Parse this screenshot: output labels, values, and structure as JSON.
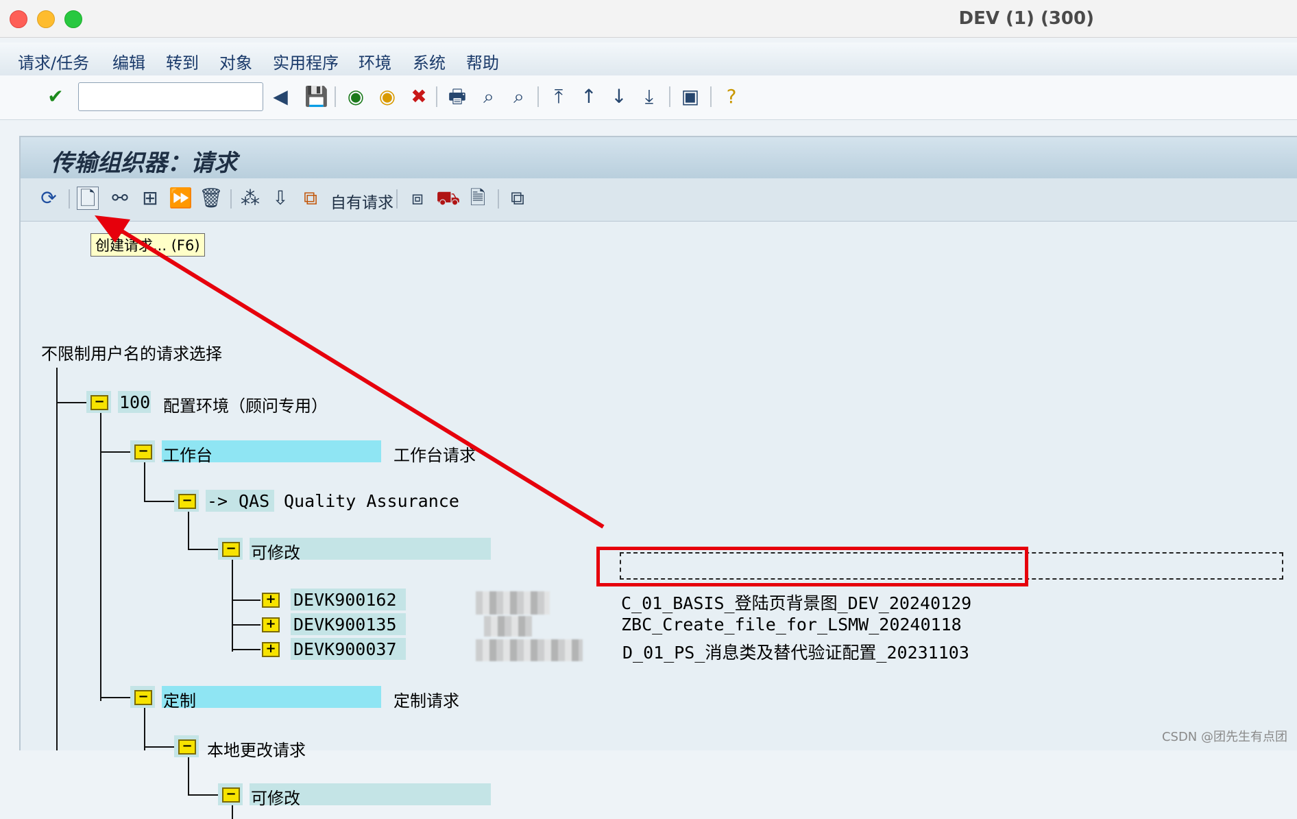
{
  "window": {
    "title": "DEV (1) (300)"
  },
  "menubar": {
    "items": [
      "请求/任务",
      "编辑",
      "转到",
      "对象",
      "实用程序",
      "环境",
      "系统",
      "帮助"
    ]
  },
  "toolbar": {
    "command_field_value": ""
  },
  "page": {
    "title": "传输组织器：请求",
    "own_requests_label": "自有请求",
    "tooltip": "创建请求... (F6)"
  },
  "tree": {
    "root_label": "不限制用户名的请求选择",
    "client": {
      "number": "100",
      "label": "配置环境（顾问专用）"
    },
    "workbench": {
      "label": "工作台",
      "description": "工作台请求"
    },
    "target": {
      "prefix": "->",
      "system": "QAS",
      "description": "Quality Assurance"
    },
    "modifiable_label": "可修改",
    "requests": [
      {
        "id": "DEVK900162",
        "description": "C_01_BASIS_登陆页背景图_DEV_20240129"
      },
      {
        "id": "DEVK900135",
        "description": "ZBC_Create_file_for_LSMW_20240118"
      },
      {
        "id": "DEVK900037",
        "description": "D_01_PS_消息类及替代验证配置_20231103"
      }
    ],
    "customizing": {
      "label": "定制",
      "description": "定制请求"
    },
    "local_change": {
      "label": "本地更改请求"
    },
    "modifiable_label_2": "可修改"
  },
  "watermark": "CSDN @团先生有点团",
  "colors": {
    "annotation": "#e6000c",
    "highlight_cyan": "#8fe5f3",
    "highlight_teal": "#c4e4e6",
    "folder": "#f7e300"
  }
}
